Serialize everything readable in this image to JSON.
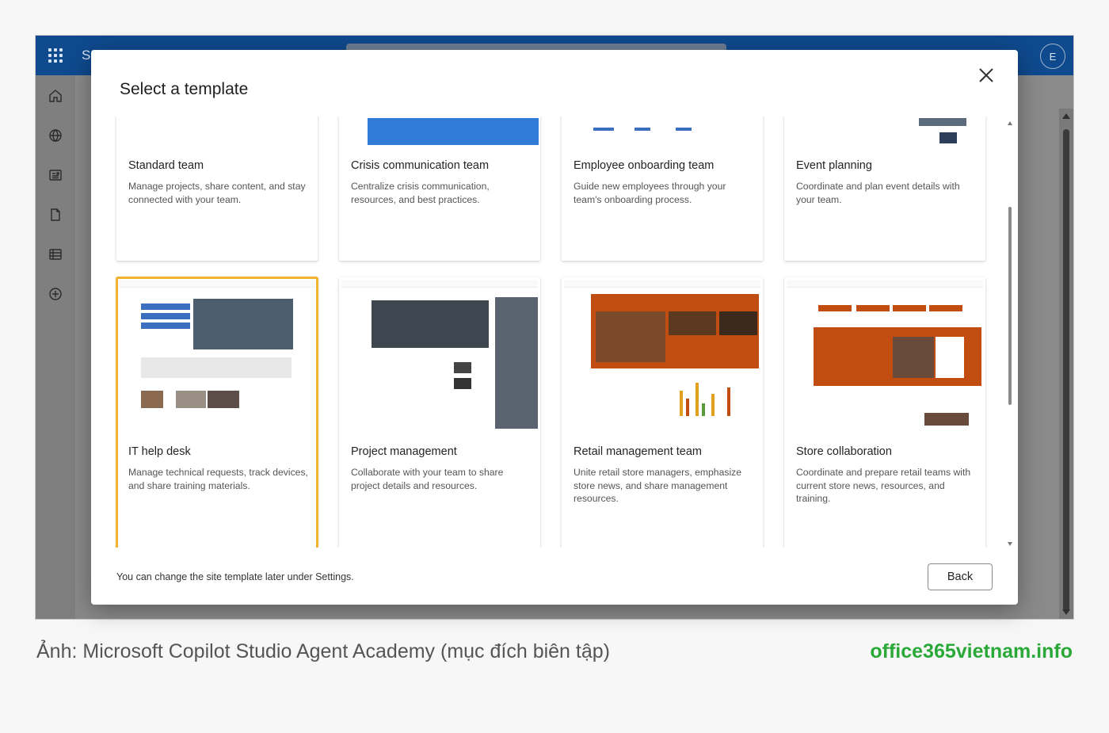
{
  "app": {
    "brand_fragment": "SI",
    "avatar_initial": "E"
  },
  "modal": {
    "title": "Select a template",
    "footer_note": "You can change the site template later under Settings.",
    "back_label": "Back"
  },
  "templates": [
    {
      "title": "Standard team",
      "description": "Manage projects, share content, and stay connected with your team."
    },
    {
      "title": "Crisis communication team",
      "description": "Centralize crisis communication, resources, and best practices."
    },
    {
      "title": "Employee onboarding team",
      "description": "Guide new employees through your team's onboarding process."
    },
    {
      "title": "Event planning",
      "description": "Coordinate and plan event details with your team."
    },
    {
      "title": "IT help desk",
      "description": "Manage technical requests, track devices, and share training materials."
    },
    {
      "title": "Project management",
      "description": "Collaborate with your team to share project details and resources."
    },
    {
      "title": "Retail management team",
      "description": "Unite retail store managers, emphasize store news, and share management resources."
    },
    {
      "title": "Store collaboration",
      "description": "Coordinate and prepare retail teams with current store news, resources, and training."
    }
  ],
  "caption": {
    "text": "Ảnh: Microsoft Copilot Studio Agent Academy (mục đích biên tập)",
    "site": "office365vietnam.info"
  },
  "colors": {
    "suite_bar": "#0f4a8f",
    "selected_outline": "#f2b430",
    "crisis_banner": "#2f7bd6",
    "retail_orange": "#c24d10",
    "watermark_green": "#2aa838"
  }
}
